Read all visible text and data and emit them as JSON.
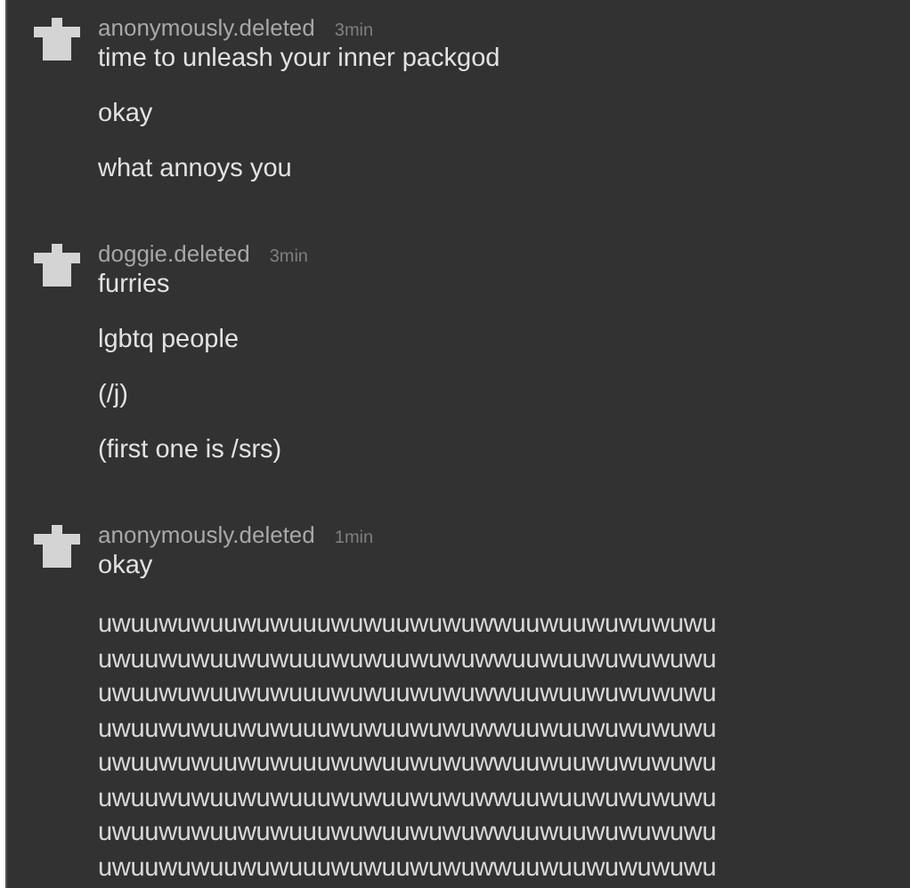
{
  "messages": [
    {
      "author": "anonymously.deleted",
      "time": "3min",
      "lines": [
        "time to unleash your inner packgod",
        "okay",
        "what annoys you"
      ]
    },
    {
      "author": "doggie.deleted",
      "time": "3min",
      "lines": [
        "furries",
        "lgbtq people",
        "(/j)",
        "(first one is /srs)"
      ]
    },
    {
      "author": "anonymously.deleted",
      "time": "1min",
      "lines": [
        "okay"
      ],
      "block": [
        "uwuuwuwuuwuwuuuwuwuuwuwuwwuuwuuwuwuwuwu",
        "uwuuwuwuuwuwuuuwuwuuwuwuwwuuwuuwuwuwuwu",
        "uwuuwuwuuwuwuuuwuwuuwuwuwwuuwuuwuwuwuwu",
        "uwuuwuwuuwuwuuuwuwuuwuwuwwuuwuuwuwuwuwu",
        "uwuuwuwuuwuwuuuwuwuuwuwuwwuuwuuwuwuwuwu",
        "uwuuwuwuuwuwuuuwuwuuwuwuwwuuwuuwuwuwuwu",
        "uwuuwuwuuwuwuuuwuwuuwuwuwwuuwuuwuwuwuwu",
        "uwuuwuwuuwuwuuuwuwuuwuwuwwuuwuuwuwuwuwu"
      ]
    }
  ]
}
